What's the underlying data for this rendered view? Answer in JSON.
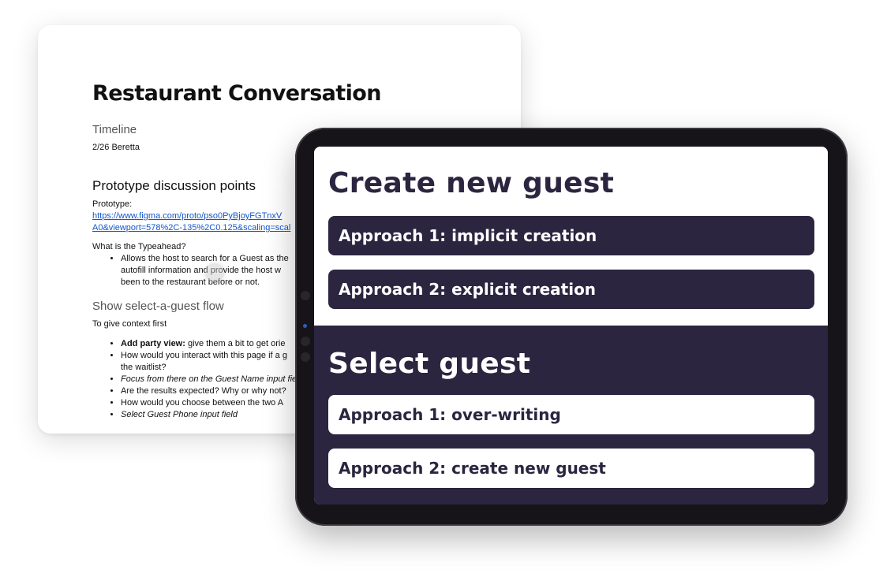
{
  "document": {
    "title": "Restaurant Conversation",
    "timeline_heading": "Timeline",
    "timeline_text": "2/26 Beretta",
    "prototype_heading": "Prototype discussion points",
    "prototype_label": "Prototype:",
    "prototype_link_line1": "https://www.figma.com/proto/pso0PyBjoyFGTnxV",
    "prototype_link_line2": "A0&viewport=578%2C-135%2C0.125&scaling=scal",
    "typeahead_question": "What is the Typeahead?",
    "typeahead_bullets": [
      "Allows the host to search for a Guest as the",
      "autofill information and provide the host w",
      "been to the restaurant before or not."
    ],
    "flow_heading": "Show select-a-guest flow",
    "flow_intro": "To give context first",
    "flow_bullets": [
      {
        "bold": "Add party view:",
        "text": " give them a bit to get orie"
      },
      {
        "text": "How would you interact with this page if a g"
      },
      {
        "text": "the waitlist?"
      },
      {
        "text": "Focus from there on the Guest Name input fie"
      },
      {
        "text": "Are the results expected? Why or why not?"
      },
      {
        "text": "How would you choose between the two A"
      },
      {
        "text": "Select Guest Phone input field"
      }
    ]
  },
  "tablet": {
    "create_section": {
      "title": "Create new guest",
      "approach_1": "Approach 1: implicit creation",
      "approach_2": "Approach 2: explicit creation"
    },
    "select_section": {
      "title": "Select guest",
      "approach_1": "Approach 1: over-writing",
      "approach_2": "Approach 2: create new guest"
    }
  },
  "colors": {
    "brand_dark": "#2b2540",
    "link": "#1155cc",
    "tablet_frame": "#161418"
  }
}
